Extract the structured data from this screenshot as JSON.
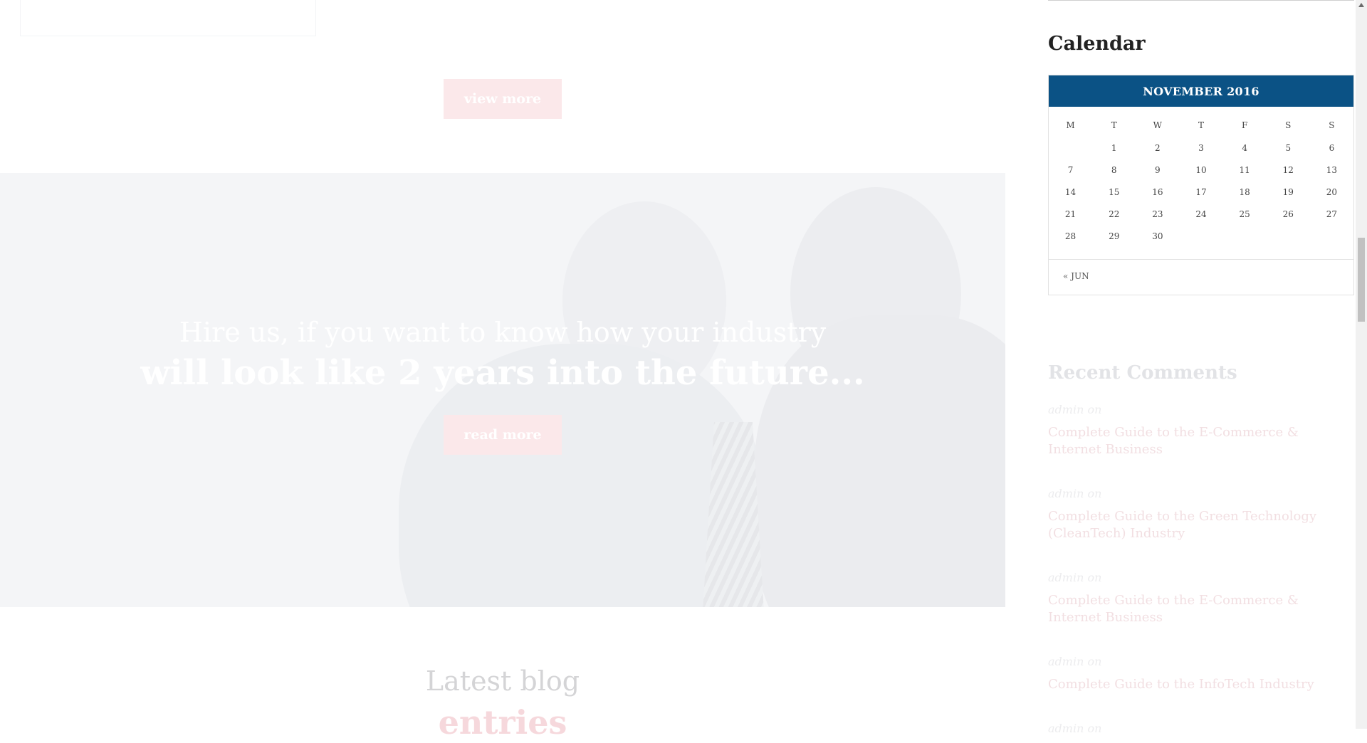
{
  "main": {
    "view_more_label": "view more",
    "hero": {
      "line1": "Hire us, if you want to know how your industry",
      "line2": "will look like 2 years into the future...",
      "read_more_label": "read more"
    },
    "blog": {
      "title_light": "Latest blog",
      "title_bold": "entries"
    }
  },
  "sidebar": {
    "calendar": {
      "title": "Calendar",
      "month": "NOVEMBER 2016",
      "weekdays": [
        "M",
        "T",
        "W",
        "T",
        "F",
        "S",
        "S"
      ],
      "weeks": [
        [
          "",
          "1",
          "2",
          "3",
          "4",
          "5",
          "6"
        ],
        [
          "7",
          "8",
          "9",
          "10",
          "11",
          "12",
          "13"
        ],
        [
          "14",
          "15",
          "16",
          "17",
          "18",
          "19",
          "20"
        ],
        [
          "21",
          "22",
          "23",
          "24",
          "25",
          "26",
          "27"
        ],
        [
          "28",
          "29",
          "30",
          "",
          "",
          "",
          ""
        ]
      ],
      "prev_label": "« JUN"
    },
    "recent_comments": {
      "title": "Recent Comments",
      "items": [
        {
          "author": "admin on",
          "link": "Complete Guide to the E-Commerce & Internet Business"
        },
        {
          "author": "admin on",
          "link": "Complete Guide to the Green Technology (CleanTech) Industry"
        },
        {
          "author": "admin on",
          "link": "Complete Guide to the E-Commerce & Internet Business"
        },
        {
          "author": "admin on",
          "link": "Complete Guide to the InfoTech Industry"
        },
        {
          "author": "admin on",
          "link": ""
        }
      ]
    }
  },
  "colors": {
    "calendar_header": "#0b5285",
    "button_pink": "#fbe8ea",
    "hero_bg": "#f4f5f7"
  }
}
